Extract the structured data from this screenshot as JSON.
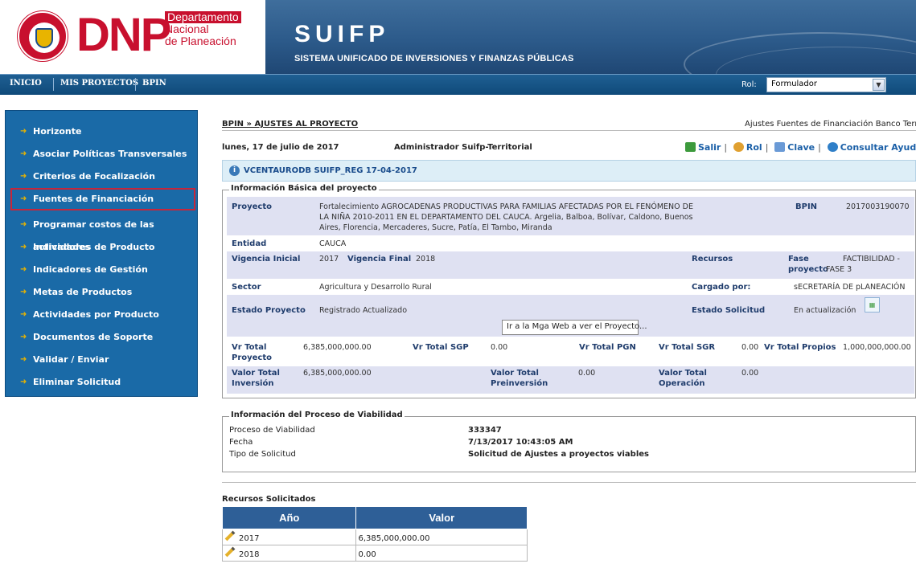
{
  "header": {
    "brand": "DNP",
    "brand_sub": [
      "Departamento",
      "Nacional",
      "de Planeación"
    ],
    "app_title": "SUIFP",
    "app_subtitle": "SISTEMA UNIFICADO DE INVERSIONES Y FINANZAS PÚBLICAS",
    "colors": {
      "brand_red": "#c8102e",
      "banner_blue": "#2c5a8a"
    }
  },
  "nav": {
    "items": [
      "INICIO",
      "MIS PROYECTOS",
      "BPIN"
    ],
    "rol_label": "Rol:",
    "rol_value": "Formulador"
  },
  "sidebar": {
    "items": [
      "Horizonte",
      "Asociar Políticas Transversales",
      "Criterios de Focalización",
      "Fuentes de Financiación",
      "Programar costos de las actividades",
      "Indicadores de Producto",
      "Indicadores de Gestión",
      "Metas de Productos",
      "Actividades por Producto",
      "Documentos de Soporte",
      "Validar / Enviar",
      "Eliminar Solicitud"
    ],
    "selected": "Fuentes de Financiación"
  },
  "page": {
    "breadcrumb": "BPIN » AJUSTES AL PROYECTO",
    "title_right": "Ajustes Fuentes de Financiación Banco Territoria",
    "date": "lunes, 17 de julio de 2017",
    "user": "Administrador Suifp-Territorial",
    "links": {
      "salir": "Salir",
      "rol": "Rol",
      "clave": "Clave",
      "ayuda": "Consultar Ayuda"
    },
    "info": "VCENTAURODB SUIFP_REG 17-04-2017"
  },
  "basic": {
    "legend": "Información Básica del proyecto",
    "proyecto_label": "Proyecto",
    "proyecto_lines": [
      "Fortalecimiento AGROCADENAS PRODUCTIVAS PARA FAMILIAS AFECTADAS POR EL FENÓMENO DE",
      "LA NIÑA 2010-2011 EN EL DEPARTAMENTO DEL CAUCA. Argelia, Balboa, Bolívar, Caldono, Buenos",
      "Aires, Florencia, Mercaderes, Sucre, Patía, El Tambo, Miranda"
    ],
    "bpin_label": "BPIN",
    "bpin": "2017003190070",
    "entidad_label": "Entidad",
    "entidad": "CAUCA",
    "vig_ini_label": "Vigencia Inicial",
    "vig_ini": "2017",
    "vig_fin_label": "Vigencia Final",
    "vig_fin": "2018",
    "recursos_label": "Recursos",
    "fase_label_1": "Fase",
    "fase_label_2": "proyecto",
    "fase_1": "FACTIBILIDAD -",
    "fase_2": "FASE 3",
    "sector_label": "Sector",
    "sector": "Agricultura y Desarrollo Rural",
    "cargado_label": "Cargado por:",
    "cargado": "sECRETARÍA DE pLANEACIÓN",
    "estado_label": "Estado Proyecto",
    "estado": "Registrado Actualizado",
    "estado_sol_label": "Estado Solicitud",
    "estado_sol": "En actualización",
    "mga_button": "Ir a la Mga Web a ver el Proyecto...",
    "vr_total_label_1": "Vr Total",
    "vr_total_label_2": "Proyecto",
    "vr_total": "6,385,000,000.00",
    "vr_sgp_label": "Vr Total SGP",
    "vr_sgp": "0.00",
    "vr_pgn_label": "Vr Total PGN",
    "vr_sgr_label": "Vr Total SGR",
    "vr_sgr": "0.00",
    "vr_propios_label": "Vr Total Propios",
    "vr_propios": "1,000,000,000.00",
    "val_inv_label_1": "Valor Total",
    "val_inv_label_2": "Inversión",
    "val_inv": "6,385,000,000.00",
    "val_pre_label_1": "Valor Total",
    "val_pre_label_2": "Preinversión",
    "val_pre": "0.00",
    "val_op_label_1": "Valor Total",
    "val_op_label_2": "Operación",
    "val_op": "0.00"
  },
  "viabilidad": {
    "legend": "Información del Proceso de Viabilidad",
    "rows": [
      {
        "label": "Proceso de Viabilidad",
        "value": "333347"
      },
      {
        "label": "Fecha",
        "value": "7/13/2017 10:43:05 AM"
      },
      {
        "label": "Tipo de Solicitud",
        "value": "Solicitud de Ajustes a proyectos viables"
      }
    ]
  },
  "recursos": {
    "title": "Recursos Solicitados",
    "headers": [
      "Año",
      "Valor"
    ],
    "rows": [
      {
        "anio": "2017",
        "valor": "6,385,000,000.00"
      },
      {
        "anio": "2018",
        "valor": "0.00"
      }
    ]
  }
}
